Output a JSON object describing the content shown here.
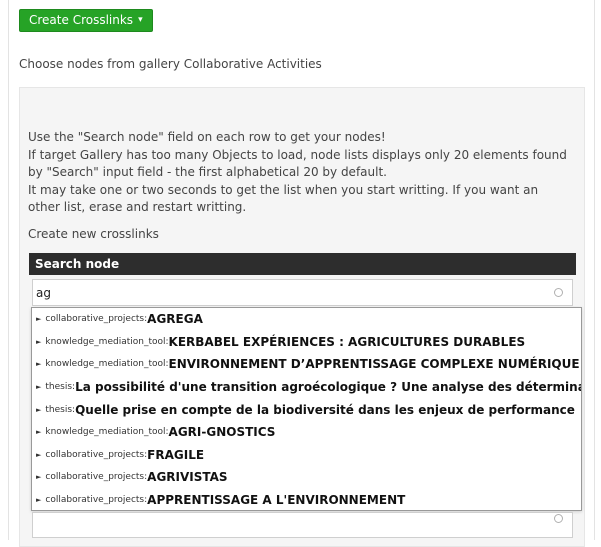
{
  "create_button": {
    "label": "Create Crosslinks",
    "caret": "▾"
  },
  "choose_text": "Choose nodes from gallery Collaborative Activities",
  "help_lines": [
    "Use the \"Search node\" field on each row to get your nodes!",
    "If target Gallery has too many Objects to load, node lists displays only 20 elements found",
    "by \"Search\" input field - the first alphabetical 20 by default.",
    "It may take one or two seconds to get the list when you start writting. If you want an",
    "other list, erase and restart writting."
  ],
  "create_new_label": "Create new crosslinks",
  "search_header": "Search node",
  "search": {
    "value": "ag"
  },
  "results": [
    {
      "prefix": "collaborative_projects:",
      "name": "AGREGA"
    },
    {
      "prefix": "knowledge_mediation_tool:",
      "name": "KERBABEL EXPÉRIENCES : AGRICULTURES DURABLES"
    },
    {
      "prefix": "knowledge_mediation_tool:",
      "name": "ENVIRONNEMENT D’APPRENTISSAGE COMPLEXE  NUMÉRIQUE"
    },
    {
      "prefix": "thesis:",
      "name": "La possibilité d'une transition agroécologique ? Une analyse des déterminants"
    },
    {
      "prefix": "thesis:",
      "name": "Quelle prise en compte de la biodiversité dans les enjeux de performance"
    },
    {
      "prefix": "knowledge_mediation_tool:",
      "name": "AGRI-GNOSTICS"
    },
    {
      "prefix": "collaborative_projects:",
      "name": "FRAGILE"
    },
    {
      "prefix": "collaborative_projects:",
      "name": "AGRIVISTAS"
    },
    {
      "prefix": "collaborative_projects:",
      "name": "APPRENTISSAGE A L'ENVIRONNEMENT"
    }
  ],
  "bullet_glyph": "►",
  "colors": {
    "button_green": "#26a326",
    "header_dark": "#2d2d2d"
  }
}
